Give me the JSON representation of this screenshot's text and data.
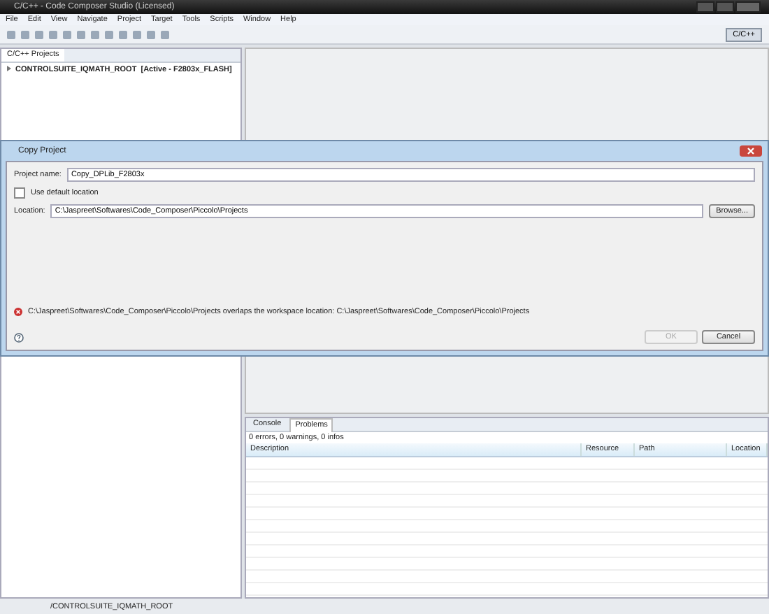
{
  "window": {
    "title": "C/C++ - Code Composer Studio (Licensed)"
  },
  "menu": [
    "File",
    "Edit",
    "View",
    "Navigate",
    "Project",
    "Target",
    "Tools",
    "Scripts",
    "Window",
    "Help"
  ],
  "perspective": {
    "label": "C/C++",
    "selected": true
  },
  "project_explorer": {
    "tab": "C/C++ Projects",
    "items": [
      {
        "name": "CONTROLSUITE_IQMATH_ROOT",
        "detail": "[Active - F2803x_FLASH]",
        "expanded": false
      }
    ]
  },
  "dialog": {
    "title": "Copy Project",
    "project_name_label": "Project name:",
    "project_name": "Copy_DPLib_F2803x",
    "use_default": {
      "label": "Use default location",
      "checked": false
    },
    "location_label": "Location:",
    "location": "C:\\Jaspreet\\Softwares\\Code_Composer\\Piccolo\\Projects",
    "browse": "Browse...",
    "error": "C:\\Jaspreet\\Softwares\\Code_Composer\\Piccolo\\Projects overlaps the workspace location: C:\\Jaspreet\\Softwares\\Code_Composer\\Piccolo\\Projects",
    "buttons": [
      {
        "label": "OK",
        "disabled": true
      },
      {
        "label": "Cancel",
        "disabled": false
      }
    ]
  },
  "bottom_panel": {
    "tabs": [
      {
        "label": "Console",
        "selected": false
      },
      {
        "label": "Problems",
        "selected": true
      }
    ],
    "summary": "0 errors, 0 warnings, 0 infos",
    "columns": [
      "Description",
      "Resource",
      "Path",
      "Location"
    ]
  },
  "status_bar": {
    "text": "/CONTROLSUITE_IQMATH_ROOT"
  }
}
